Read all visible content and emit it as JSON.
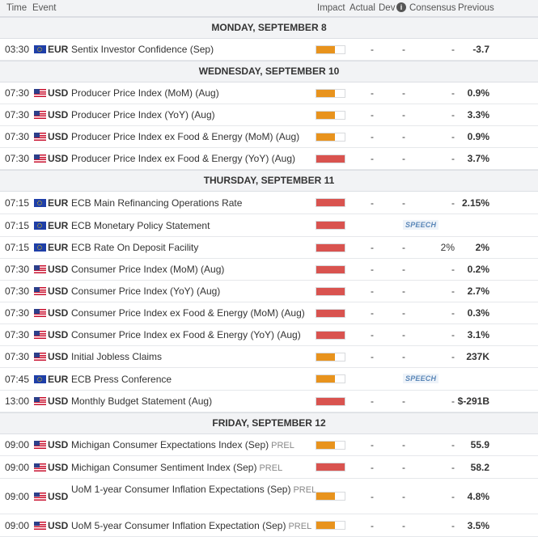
{
  "header": {
    "time": "Time",
    "event": "Event",
    "impact": "Impact",
    "actual": "Actual",
    "dev": "Dev",
    "info_icon": "i",
    "consensus": "Consensus",
    "previous": "Previous"
  },
  "colors": {
    "medium": "#e8931d",
    "high": "#d9534f"
  },
  "sections": [
    {
      "day": "MONDAY, SEPTEMBER 8",
      "rows": [
        {
          "time": "03:30",
          "flag": "eu",
          "currency": "EUR",
          "event": "Sentix Investor Confidence (Sep)",
          "impact": "medium",
          "actual": "-",
          "dev": "-",
          "consensus": "-",
          "previous": "-3.7",
          "h": 27
        }
      ]
    },
    {
      "day": "WEDNESDAY, SEPTEMBER 10",
      "rows": [
        {
          "time": "07:30",
          "flag": "us",
          "currency": "USD",
          "event": "Producer Price Index (MoM) (Aug)",
          "impact": "medium",
          "actual": "-",
          "dev": "-",
          "consensus": "-",
          "previous": "0.9%",
          "h": 27
        },
        {
          "time": "07:30",
          "flag": "us",
          "currency": "USD",
          "event": "Producer Price Index (YoY) (Aug)",
          "impact": "medium",
          "actual": "-",
          "dev": "-",
          "consensus": "-",
          "previous": "3.3%",
          "h": 27
        },
        {
          "time": "07:30",
          "flag": "us",
          "currency": "USD",
          "event": "Producer Price Index ex Food & Energy (MoM) (Aug)",
          "impact": "medium",
          "actual": "-",
          "dev": "-",
          "consensus": "-",
          "previous": "0.9%",
          "h": 27
        },
        {
          "time": "07:30",
          "flag": "us",
          "currency": "USD",
          "event": "Producer Price Index ex Food & Energy (YoY) (Aug)",
          "impact": "high",
          "actual": "-",
          "dev": "-",
          "consensus": "-",
          "previous": "3.7%",
          "h": 27
        }
      ]
    },
    {
      "day": "THURSDAY, SEPTEMBER 11",
      "rows": [
        {
          "time": "07:15",
          "flag": "eu",
          "currency": "EUR",
          "event": "ECB Main Refinancing Operations Rate",
          "impact": "high",
          "actual": "-",
          "dev": "-",
          "consensus": "-",
          "previous": "2.15%",
          "h": 28
        },
        {
          "time": "07:15",
          "flag": "eu",
          "currency": "EUR",
          "event": "ECB Monetary Policy Statement",
          "impact": "high",
          "speech": "SPEECH",
          "h": 28
        },
        {
          "time": "07:15",
          "flag": "eu",
          "currency": "EUR",
          "event": "ECB Rate On Deposit Facility",
          "impact": "high",
          "actual": "-",
          "dev": "-",
          "consensus": "2%",
          "previous": "2%",
          "h": 27
        },
        {
          "time": "07:30",
          "flag": "us",
          "currency": "USD",
          "event": "Consumer Price Index (MoM) (Aug)",
          "impact": "high",
          "actual": "-",
          "dev": "-",
          "consensus": "-",
          "previous": "0.2%",
          "h": 27
        },
        {
          "time": "07:30",
          "flag": "us",
          "currency": "USD",
          "event": "Consumer Price Index (YoY) (Aug)",
          "impact": "high",
          "actual": "-",
          "dev": "-",
          "consensus": "-",
          "previous": "2.7%",
          "h": 27
        },
        {
          "time": "07:30",
          "flag": "us",
          "currency": "USD",
          "event": "Consumer Price Index ex Food & Energy (MoM) (Aug)",
          "impact": "high",
          "actual": "-",
          "dev": "-",
          "consensus": "-",
          "previous": "0.3%",
          "h": 27
        },
        {
          "time": "07:30",
          "flag": "us",
          "currency": "USD",
          "event": "Consumer Price Index ex Food & Energy (YoY) (Aug)",
          "impact": "high",
          "actual": "-",
          "dev": "-",
          "consensus": "-",
          "previous": "3.1%",
          "h": 27
        },
        {
          "time": "07:30",
          "flag": "us",
          "currency": "USD",
          "event": "Initial Jobless Claims",
          "impact": "medium",
          "actual": "-",
          "dev": "-",
          "consensus": "-",
          "previous": "237K",
          "h": 27
        },
        {
          "time": "07:45",
          "flag": "eu",
          "currency": "EUR",
          "event": "ECB Press Conference",
          "impact": "medium",
          "speech": "SPEECH",
          "h": 28
        },
        {
          "time": "13:00",
          "flag": "us",
          "currency": "USD",
          "event": "Monthly Budget Statement (Aug)",
          "impact": "high",
          "actual": "-",
          "dev": "-",
          "consensus": "-",
          "previous": "$-291B",
          "h": 27
        }
      ]
    },
    {
      "day": "FRIDAY, SEPTEMBER 12",
      "rows": [
        {
          "time": "09:00",
          "flag": "us",
          "currency": "USD",
          "event": "Michigan Consumer Expectations Index (Sep)",
          "prel": "PREL",
          "impact": "medium",
          "actual": "-",
          "dev": "-",
          "consensus": "-",
          "previous": "55.9",
          "h": 27
        },
        {
          "time": "09:00",
          "flag": "us",
          "currency": "USD",
          "event": "Michigan Consumer Sentiment Index (Sep)",
          "prel": "PREL",
          "impact": "high",
          "actual": "-",
          "dev": "-",
          "consensus": "-",
          "previous": "58.2",
          "h": 28
        },
        {
          "time": "09:00",
          "flag": "us",
          "currency": "USD",
          "event": "UoM 1-year Consumer Inflation Expectations (Sep)",
          "prel": "PREL",
          "impact": "medium",
          "actual": "-",
          "dev": "-",
          "consensus": "-",
          "previous": "4.8%",
          "h": 44,
          "two_line": true
        },
        {
          "time": "09:00",
          "flag": "us",
          "currency": "USD",
          "event": "UoM 5-year Consumer Inflation Expectation (Sep)",
          "prel": "PREL",
          "impact": "medium",
          "actual": "-",
          "dev": "-",
          "consensus": "-",
          "previous": "3.5%",
          "h": 28
        }
      ]
    }
  ]
}
